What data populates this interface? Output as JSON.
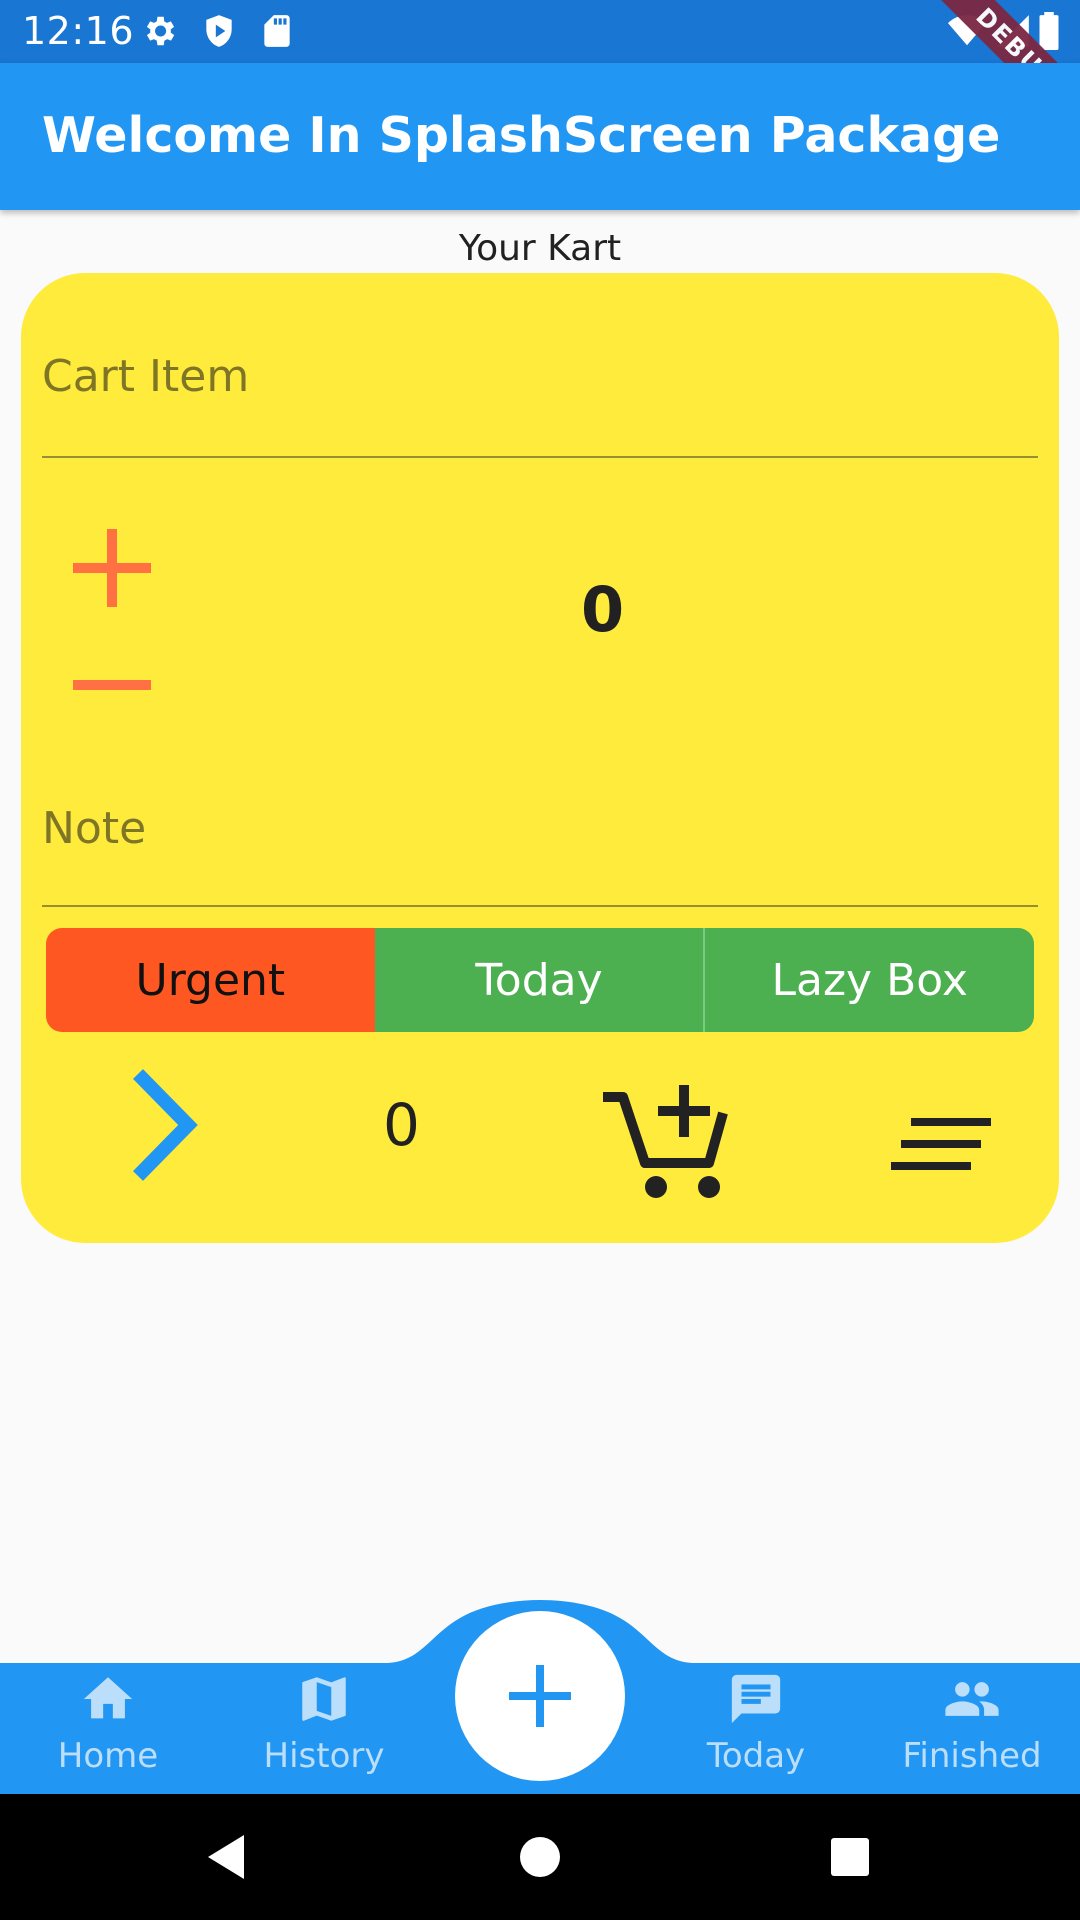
{
  "status_bar": {
    "time": "12:16",
    "debug_label": "DEBUG"
  },
  "app_bar": {
    "title": "Welcome In SplashScreen Package"
  },
  "section_title": "Your Kart",
  "card": {
    "item_field": {
      "placeholder": "Cart Item",
      "value": ""
    },
    "quantity": "0",
    "note_field": {
      "placeholder": "Note",
      "value": ""
    },
    "priority_options": [
      "Urgent",
      "Today",
      "Lazy Box"
    ],
    "selected_priority": "Urgent",
    "counter": "0"
  },
  "bottom_nav": {
    "items": [
      {
        "label": "Home",
        "icon": "home-icon"
      },
      {
        "label": "History",
        "icon": "map-icon"
      },
      {
        "label": "Today",
        "icon": "chat-icon"
      },
      {
        "label": "Finished",
        "icon": "people-icon"
      }
    ],
    "fab_icon": "plus-icon"
  },
  "colors": {
    "app_bar": "#2196f3",
    "status_bar": "#1976d2",
    "card": "#ffeb3b",
    "urgent": "#ff5722",
    "segment_green": "#4caf50",
    "accent_orange": "#ff7043"
  }
}
